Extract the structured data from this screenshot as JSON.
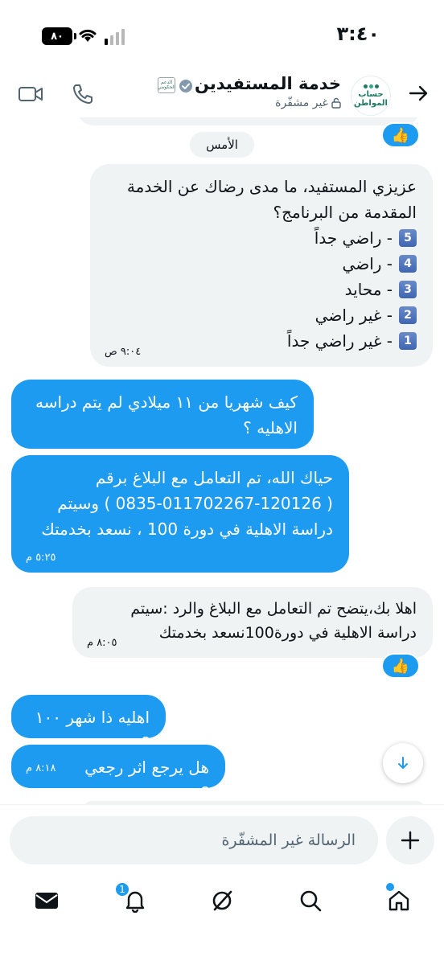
{
  "status_bar": {
    "time": "٣:٤٠",
    "battery": "٨٠"
  },
  "header": {
    "channel_name": "خدمة المستفيدين",
    "encryption_status": "غير مشفّرة",
    "avatar_text_line1": "حساب",
    "avatar_text_line2": "المواطن",
    "gov_badge_text": "الدعم الحكومي"
  },
  "chat": {
    "date_separator": "الأمس",
    "messages": [
      {
        "direction": "incoming",
        "text_line1": "عزيزي المستفيد، ما مدى رضاك عن الخدمة",
        "text_line2": "المقدمة من البرنامج؟",
        "options": [
          {
            "key": "5",
            "label": "- راضي جداً"
          },
          {
            "key": "4",
            "label": "- راضي"
          },
          {
            "key": "3",
            "label": "- محايد"
          },
          {
            "key": "2",
            "label": "- غير راضي"
          },
          {
            "key": "1",
            "label": "- غير راضي جداً"
          }
        ],
        "time": "٩:٠٤ ص"
      },
      {
        "direction": "outgoing",
        "text_line1": "كيف شهريا من ١١ ميلادي لم يتم دراسه",
        "text_line2": "الاهليه ؟"
      },
      {
        "direction": "outgoing",
        "text_line1": "حياك الله، تم التعامل مع البلاغ برقم",
        "text_line2": "( 0835-011702267-120126 ) وسيتم",
        "text_line3": "دراسة الاهلية في دورة 100 ، نسعد بخدمتك",
        "time": "٥:٢٥ م"
      },
      {
        "direction": "incoming",
        "text_line1": "اهلا بك،يتضح تم التعامل مع البلاغ والرد :سيتم",
        "text_line2": "دراسة الاهلية في دورة100نسعد بخدمتك",
        "time": "٨:٠٥ م"
      },
      {
        "direction": "outgoing",
        "text_line1": "اهليه ذا شهر ١٠٠ ؟"
      },
      {
        "direction": "outgoing",
        "text_line1": "هل يرجع اثر رجعي ؟",
        "time": "٨:١٨ م"
      }
    ],
    "reaction_emoji": "👍"
  },
  "composer": {
    "placeholder": "الرسالة غير المشفّرة"
  },
  "bottom_nav": {
    "notifications_badge": "1",
    "items": [
      "home",
      "search",
      "grok",
      "notifications",
      "messages"
    ]
  },
  "colors": {
    "accent": "#1d9bf0",
    "incoming_bubble": "#eff3f4",
    "text": "#0f1419",
    "secondary_text": "#536471"
  }
}
